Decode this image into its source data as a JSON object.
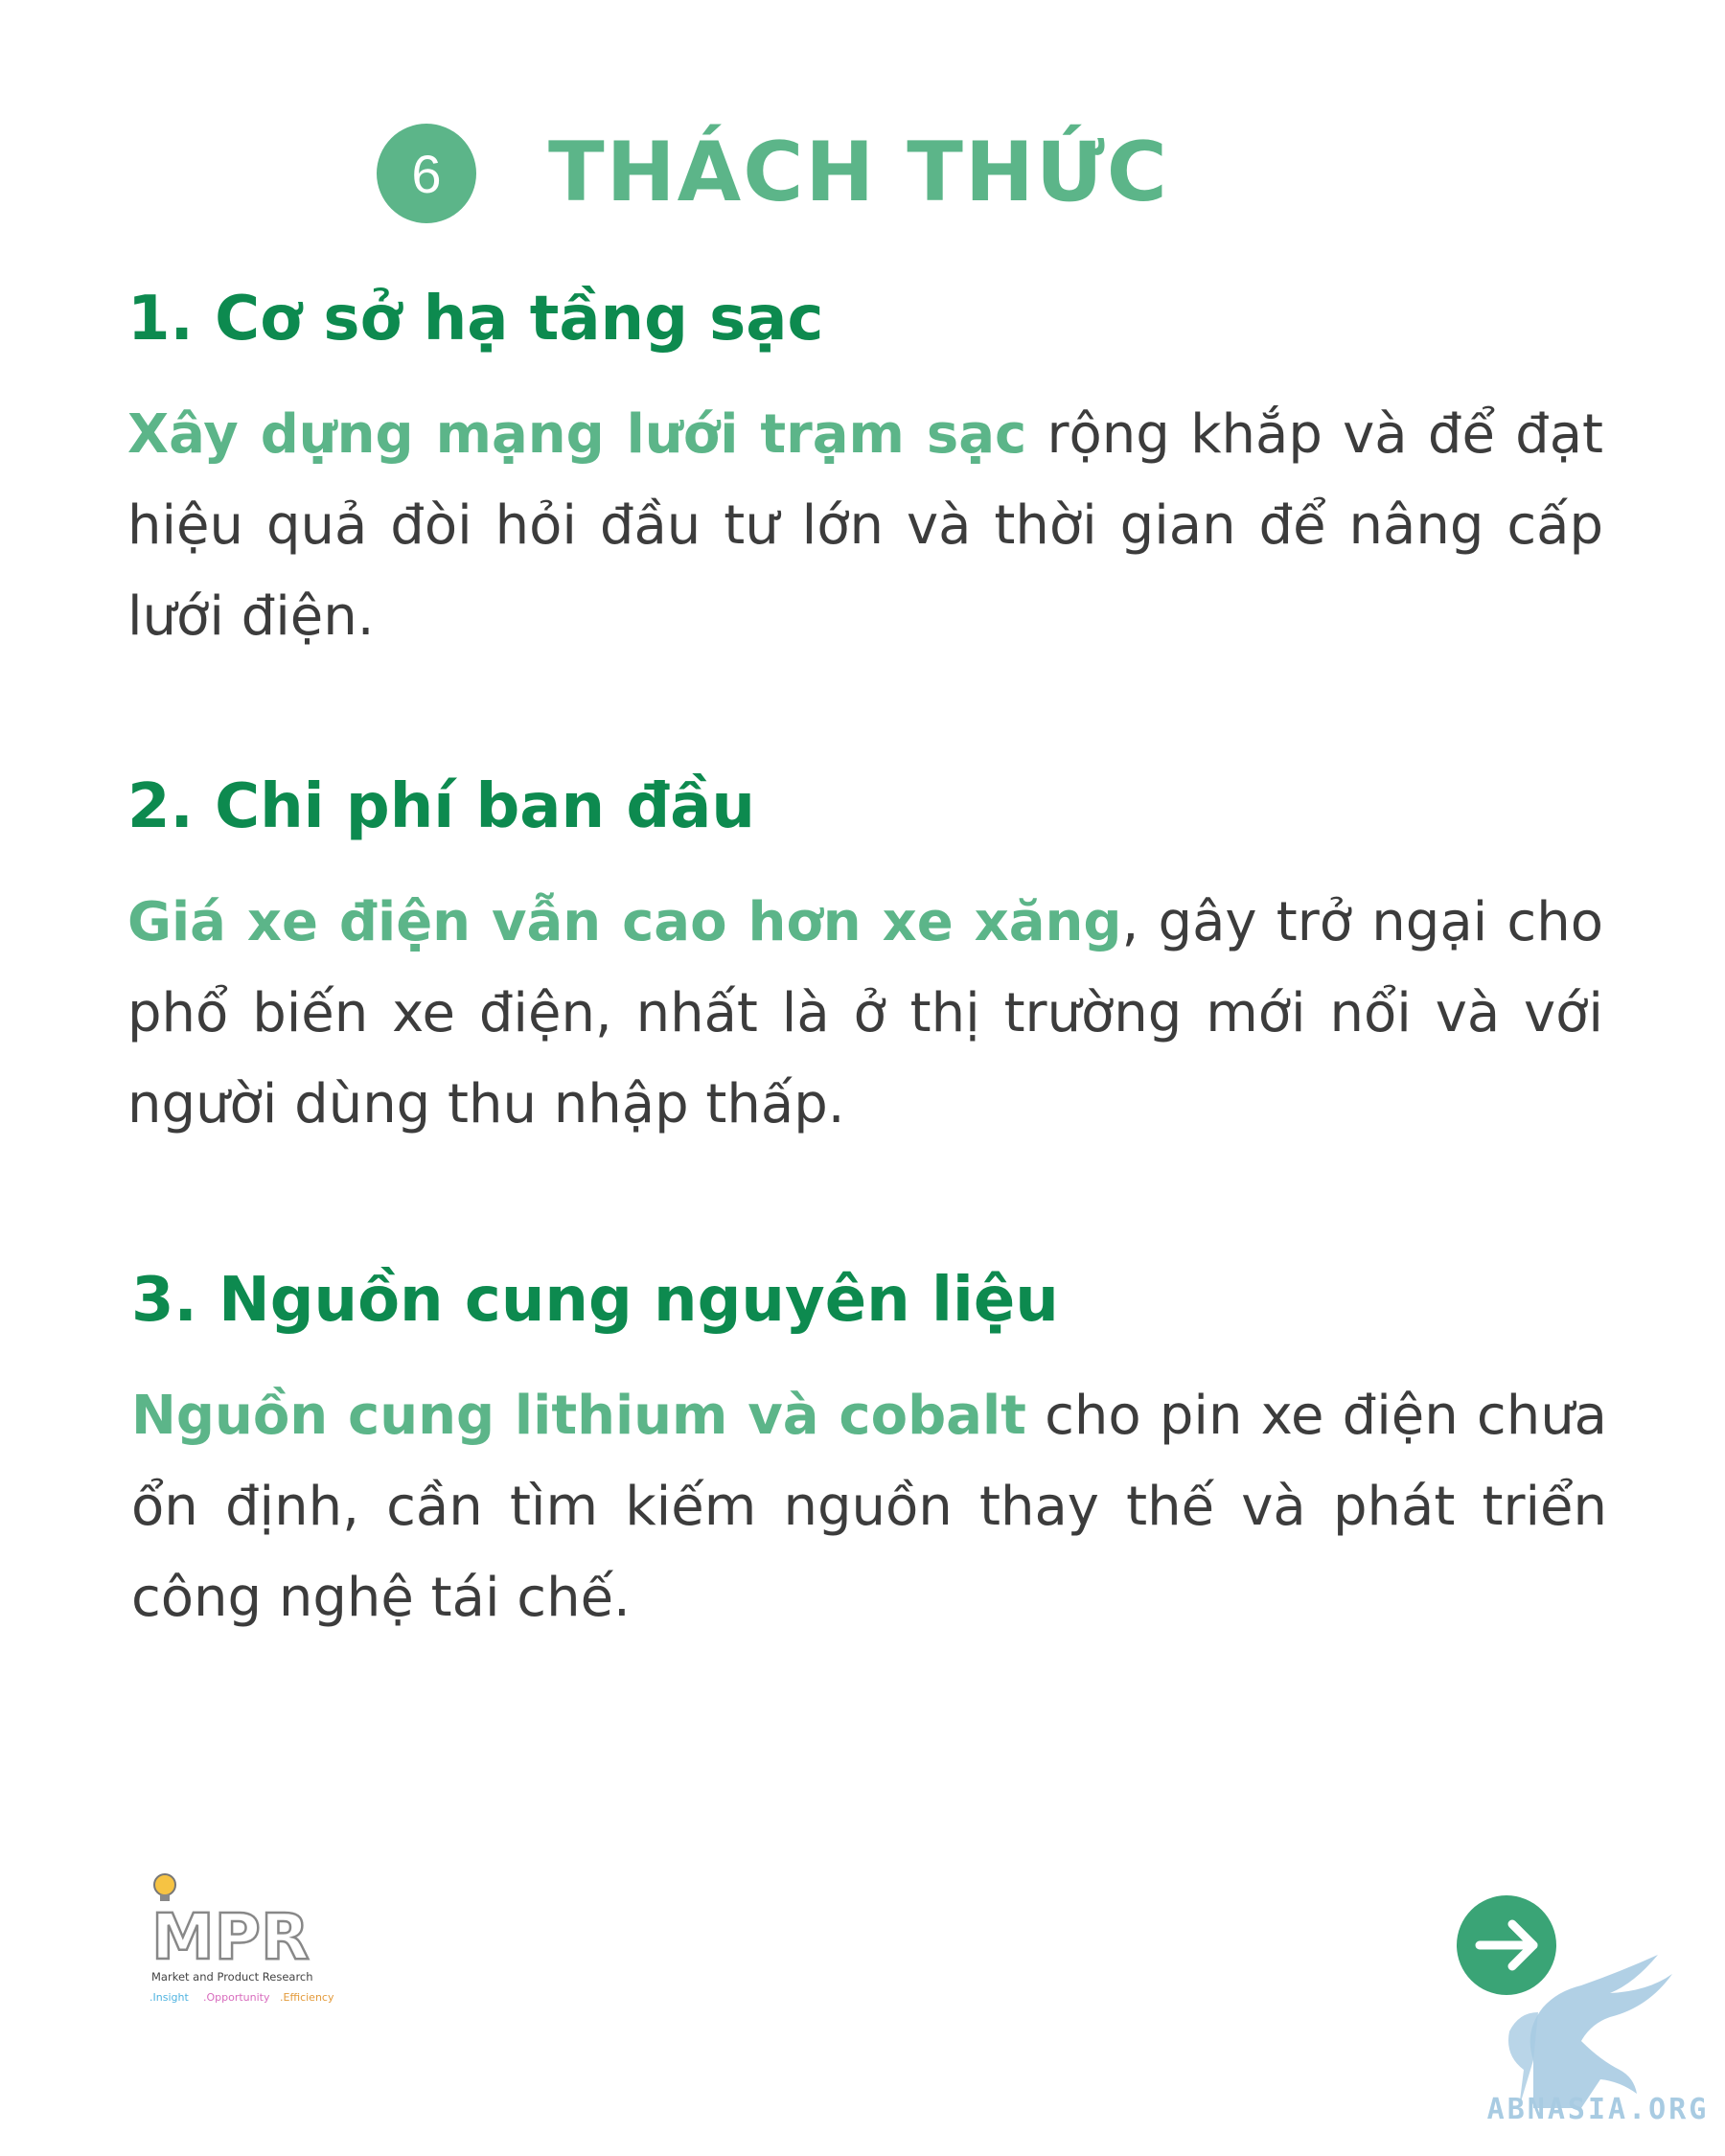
{
  "header": {
    "number": "6",
    "title": "THÁCH THỨC"
  },
  "sections": [
    {
      "heading": "1. Cơ sở hạ tầng sạc",
      "highlight": "Xây dựng mạng lưới trạm sạc",
      "text": " rộng khắp và để đạt hiệu quả đòi hỏi đầu tư lớn và thời gian để nâng cấp lưới điện."
    },
    {
      "heading": "2. Chi phí ban đầu",
      "highlight": "Giá xe điện vẫn cao hơn xe xăng",
      "text": ", gây trở ngại cho phổ biến xe điện, nhất là ở thị trường mới nổi và với người dùng thu nhập thấp."
    },
    {
      "heading": "3. Nguồn cung nguyên liệu",
      "highlight": "Nguồn cung lithium và cobalt",
      "text": " cho pin xe điện chưa ổn định, cần tìm kiếm nguồn thay thế và phát triển công nghệ tái chế."
    }
  ],
  "footer": {
    "logo_name": "MPR",
    "logo_subtitle": "Market and Product Research",
    "logo_tagline_1": ".Insight",
    "logo_tagline_2": ".Opportunity",
    "logo_tagline_3": ".Efficiency",
    "watermark": "ABNASIA.ORG",
    "next_icon": "arrow-right-icon"
  },
  "colors": {
    "accent": "#5cb589",
    "heading": "#0d8a4f",
    "text": "#3c3c3c",
    "watermark": "#a8cbe2"
  }
}
